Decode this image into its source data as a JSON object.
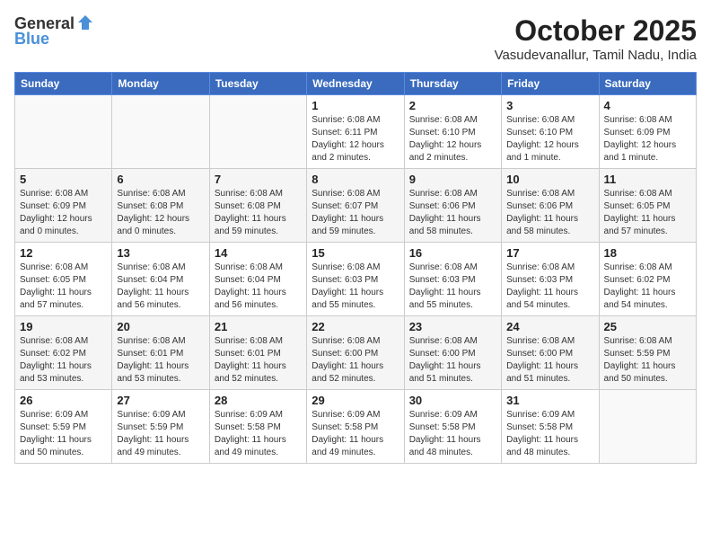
{
  "header": {
    "logo_general": "General",
    "logo_blue": "Blue",
    "month_title": "October 2025",
    "subtitle": "Vasudevanallur, Tamil Nadu, India"
  },
  "weekdays": [
    "Sunday",
    "Monday",
    "Tuesday",
    "Wednesday",
    "Thursday",
    "Friday",
    "Saturday"
  ],
  "weeks": [
    [
      {
        "day": "",
        "info": ""
      },
      {
        "day": "",
        "info": ""
      },
      {
        "day": "",
        "info": ""
      },
      {
        "day": "1",
        "info": "Sunrise: 6:08 AM\nSunset: 6:11 PM\nDaylight: 12 hours\nand 2 minutes."
      },
      {
        "day": "2",
        "info": "Sunrise: 6:08 AM\nSunset: 6:10 PM\nDaylight: 12 hours\nand 2 minutes."
      },
      {
        "day": "3",
        "info": "Sunrise: 6:08 AM\nSunset: 6:10 PM\nDaylight: 12 hours\nand 1 minute."
      },
      {
        "day": "4",
        "info": "Sunrise: 6:08 AM\nSunset: 6:09 PM\nDaylight: 12 hours\nand 1 minute."
      }
    ],
    [
      {
        "day": "5",
        "info": "Sunrise: 6:08 AM\nSunset: 6:09 PM\nDaylight: 12 hours\nand 0 minutes."
      },
      {
        "day": "6",
        "info": "Sunrise: 6:08 AM\nSunset: 6:08 PM\nDaylight: 12 hours\nand 0 minutes."
      },
      {
        "day": "7",
        "info": "Sunrise: 6:08 AM\nSunset: 6:08 PM\nDaylight: 11 hours\nand 59 minutes."
      },
      {
        "day": "8",
        "info": "Sunrise: 6:08 AM\nSunset: 6:07 PM\nDaylight: 11 hours\nand 59 minutes."
      },
      {
        "day": "9",
        "info": "Sunrise: 6:08 AM\nSunset: 6:06 PM\nDaylight: 11 hours\nand 58 minutes."
      },
      {
        "day": "10",
        "info": "Sunrise: 6:08 AM\nSunset: 6:06 PM\nDaylight: 11 hours\nand 58 minutes."
      },
      {
        "day": "11",
        "info": "Sunrise: 6:08 AM\nSunset: 6:05 PM\nDaylight: 11 hours\nand 57 minutes."
      }
    ],
    [
      {
        "day": "12",
        "info": "Sunrise: 6:08 AM\nSunset: 6:05 PM\nDaylight: 11 hours\nand 57 minutes."
      },
      {
        "day": "13",
        "info": "Sunrise: 6:08 AM\nSunset: 6:04 PM\nDaylight: 11 hours\nand 56 minutes."
      },
      {
        "day": "14",
        "info": "Sunrise: 6:08 AM\nSunset: 6:04 PM\nDaylight: 11 hours\nand 56 minutes."
      },
      {
        "day": "15",
        "info": "Sunrise: 6:08 AM\nSunset: 6:03 PM\nDaylight: 11 hours\nand 55 minutes."
      },
      {
        "day": "16",
        "info": "Sunrise: 6:08 AM\nSunset: 6:03 PM\nDaylight: 11 hours\nand 55 minutes."
      },
      {
        "day": "17",
        "info": "Sunrise: 6:08 AM\nSunset: 6:03 PM\nDaylight: 11 hours\nand 54 minutes."
      },
      {
        "day": "18",
        "info": "Sunrise: 6:08 AM\nSunset: 6:02 PM\nDaylight: 11 hours\nand 54 minutes."
      }
    ],
    [
      {
        "day": "19",
        "info": "Sunrise: 6:08 AM\nSunset: 6:02 PM\nDaylight: 11 hours\nand 53 minutes."
      },
      {
        "day": "20",
        "info": "Sunrise: 6:08 AM\nSunset: 6:01 PM\nDaylight: 11 hours\nand 53 minutes."
      },
      {
        "day": "21",
        "info": "Sunrise: 6:08 AM\nSunset: 6:01 PM\nDaylight: 11 hours\nand 52 minutes."
      },
      {
        "day": "22",
        "info": "Sunrise: 6:08 AM\nSunset: 6:00 PM\nDaylight: 11 hours\nand 52 minutes."
      },
      {
        "day": "23",
        "info": "Sunrise: 6:08 AM\nSunset: 6:00 PM\nDaylight: 11 hours\nand 51 minutes."
      },
      {
        "day": "24",
        "info": "Sunrise: 6:08 AM\nSunset: 6:00 PM\nDaylight: 11 hours\nand 51 minutes."
      },
      {
        "day": "25",
        "info": "Sunrise: 6:08 AM\nSunset: 5:59 PM\nDaylight: 11 hours\nand 50 minutes."
      }
    ],
    [
      {
        "day": "26",
        "info": "Sunrise: 6:09 AM\nSunset: 5:59 PM\nDaylight: 11 hours\nand 50 minutes."
      },
      {
        "day": "27",
        "info": "Sunrise: 6:09 AM\nSunset: 5:59 PM\nDaylight: 11 hours\nand 49 minutes."
      },
      {
        "day": "28",
        "info": "Sunrise: 6:09 AM\nSunset: 5:58 PM\nDaylight: 11 hours\nand 49 minutes."
      },
      {
        "day": "29",
        "info": "Sunrise: 6:09 AM\nSunset: 5:58 PM\nDaylight: 11 hours\nand 49 minutes."
      },
      {
        "day": "30",
        "info": "Sunrise: 6:09 AM\nSunset: 5:58 PM\nDaylight: 11 hours\nand 48 minutes."
      },
      {
        "day": "31",
        "info": "Sunrise: 6:09 AM\nSunset: 5:58 PM\nDaylight: 11 hours\nand 48 minutes."
      },
      {
        "day": "",
        "info": ""
      }
    ]
  ]
}
